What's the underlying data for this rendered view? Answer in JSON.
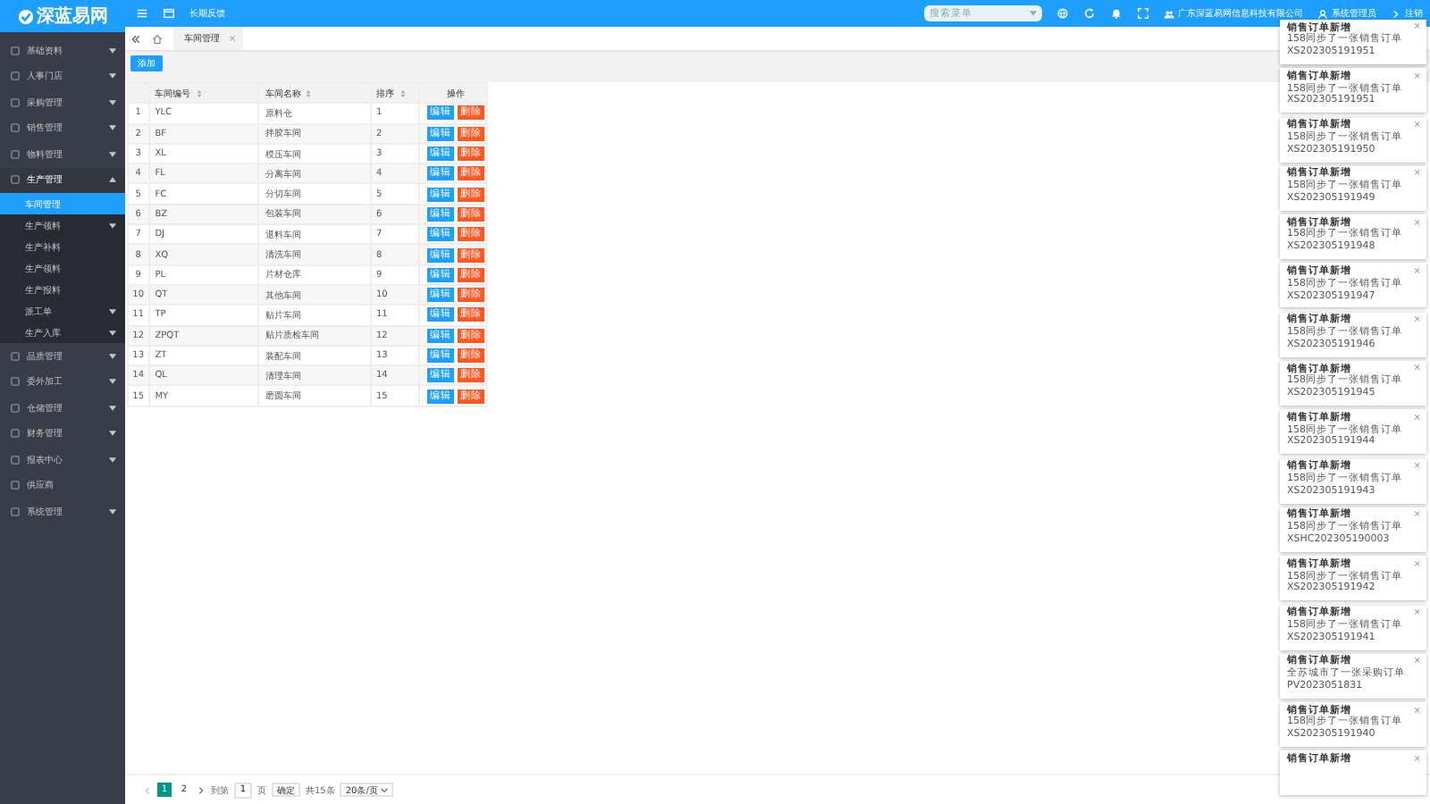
{
  "logo": {
    "text": "深蓝易网"
  },
  "sidebar": {
    "items": [
      {
        "label": "基础资料",
        "kind": "menu",
        "expanded": false,
        "selected": false
      },
      {
        "label": "人事门店",
        "kind": "menu",
        "expanded": false,
        "selected": false
      },
      {
        "label": "采购管理",
        "kind": "menu",
        "expanded": false,
        "selected": false
      },
      {
        "label": "销售管理",
        "kind": "menu",
        "expanded": false,
        "selected": false
      },
      {
        "label": "物料管理",
        "kind": "menu",
        "expanded": false,
        "selected": false
      },
      {
        "label": "生产管理",
        "kind": "menu",
        "expanded": true,
        "selected": false,
        "children": [
          {
            "label": "车间管理",
            "kind": "link",
            "selected": true
          },
          {
            "label": "生产领料",
            "kind": "menu",
            "expanded": false,
            "selected": false
          },
          {
            "label": "生产补料",
            "kind": "link",
            "selected": false
          },
          {
            "label": "生产领料",
            "kind": "link",
            "selected": false
          },
          {
            "label": "生产报料",
            "kind": "link",
            "selected": false
          },
          {
            "label": "派工单",
            "kind": "menu",
            "expanded": false,
            "selected": false
          },
          {
            "label": "生产入库",
            "kind": "menu",
            "expanded": false,
            "selected": false
          }
        ]
      },
      {
        "label": "品质管理",
        "kind": "menu",
        "expanded": false,
        "selected": false
      },
      {
        "label": "委外加工",
        "kind": "menu",
        "expanded": false,
        "selected": false
      },
      {
        "label": "仓储管理",
        "kind": "menu",
        "expanded": false,
        "selected": false
      },
      {
        "label": "财务管理",
        "kind": "menu",
        "expanded": false,
        "selected": false
      },
      {
        "label": "报表中心",
        "kind": "menu",
        "expanded": false,
        "selected": false
      },
      {
        "label": "供应商",
        "kind": "link",
        "selected": false
      },
      {
        "label": "系统管理",
        "kind": "menu",
        "expanded": false,
        "selected": false
      }
    ]
  },
  "topbar": {
    "title": "长期反馈",
    "search": {
      "placeholder": "搜索菜单"
    },
    "company": "广东深蓝易网信息科技有限公司",
    "user": "系统管理员",
    "logout": "注销"
  },
  "tabs": [
    {
      "label": "车间管理",
      "selected": true
    }
  ],
  "toolbar": {
    "add_button": "添加"
  },
  "table": {
    "columns": [
      "车间编号",
      "车间名称",
      "排序",
      "操作"
    ],
    "rows": [
      {
        "index": "1",
        "code": "YLC",
        "name": "原料仓",
        "order": "1",
        "edit": "编辑",
        "delete": "删除"
      },
      {
        "index": "2",
        "code": "BF",
        "name": "拌胶车间",
        "order": "2",
        "edit": "编辑",
        "delete": "删除"
      },
      {
        "index": "3",
        "code": "XL",
        "name": "模压车间",
        "order": "3",
        "edit": "编辑",
        "delete": "删除"
      },
      {
        "index": "4",
        "code": "FL",
        "name": "分离车间",
        "order": "4",
        "edit": "编辑",
        "delete": "删除"
      },
      {
        "index": "5",
        "code": "FC",
        "name": "分切车间",
        "order": "5",
        "edit": "编辑",
        "delete": "删除"
      },
      {
        "index": "6",
        "code": "BZ",
        "name": "包装车间",
        "order": "6",
        "edit": "编辑",
        "delete": "删除"
      },
      {
        "index": "7",
        "code": "DJ",
        "name": "退料车间",
        "order": "7",
        "edit": "编辑",
        "delete": "删除"
      },
      {
        "index": "8",
        "code": "XQ",
        "name": "清洗车间",
        "order": "8",
        "edit": "编辑",
        "delete": "删除"
      },
      {
        "index": "9",
        "code": "PL",
        "name": "片材仓库",
        "order": "9",
        "edit": "编辑",
        "delete": "删除"
      },
      {
        "index": "10",
        "code": "QT",
        "name": "其他车间",
        "order": "10",
        "edit": "编辑",
        "delete": "删除"
      },
      {
        "index": "11",
        "code": "TP",
        "name": "贴片车间",
        "order": "11",
        "edit": "编辑",
        "delete": "删除"
      },
      {
        "index": "12",
        "code": "ZPQT",
        "name": "贴片质检车间",
        "order": "12",
        "edit": "编辑",
        "delete": "删除"
      },
      {
        "index": "13",
        "code": "ZT",
        "name": "装配车间",
        "order": "13",
        "edit": "编辑",
        "delete": "删除"
      },
      {
        "index": "14",
        "code": "QL",
        "name": "清理车间",
        "order": "14",
        "edit": "编辑",
        "delete": "删除"
      },
      {
        "index": "15",
        "code": "MY",
        "name": "磨圆车间",
        "order": "15",
        "edit": "编辑",
        "delete": "删除"
      }
    ]
  },
  "pagination": {
    "pages": [
      {
        "label": "1",
        "selected": true
      },
      {
        "label": "2",
        "selected": false
      }
    ],
    "goto_label": "到第",
    "page_value": "1",
    "page_suffix": "页",
    "confirm": "确定",
    "total": "共15条",
    "page_size": "20条/页"
  },
  "notifications": [
    {
      "title": "销售订单新增",
      "body": "158同步了一张销售订单",
      "number": "XS202305191951"
    },
    {
      "title": "销售订单新增",
      "body": "158同步了一张销售订单",
      "number": "XS202305191951"
    },
    {
      "title": "销售订单新增",
      "body": "158同步了一张销售订单",
      "number": "XS202305191950"
    },
    {
      "title": "销售订单新增",
      "body": "158同步了一张销售订单",
      "number": "XS202305191949"
    },
    {
      "title": "销售订单新增",
      "body": "158同步了一张销售订单",
      "number": "XS202305191948"
    },
    {
      "title": "销售订单新增",
      "body": "158同步了一张销售订单",
      "number": "XS202305191947"
    },
    {
      "title": "销售订单新增",
      "body": "158同步了一张销售订单",
      "number": "XS202305191946"
    },
    {
      "title": "销售订单新增",
      "body": "158同步了一张销售订单",
      "number": "XS202305191945"
    },
    {
      "title": "销售订单新增",
      "body": "158同步了一张销售订单",
      "number": "XS202305191944"
    },
    {
      "title": "销售订单新增",
      "body": "158同步了一张销售订单",
      "number": "XS202305191943"
    },
    {
      "title": "销售订单新增",
      "body": "158同步了一张销售订单",
      "number": "XSHC202305190003"
    },
    {
      "title": "销售订单新增",
      "body": "158同步了一张销售订单",
      "number": "XS202305191942"
    },
    {
      "title": "销售订单新增",
      "body": "158同步了一张销售订单",
      "number": "XS202305191941"
    },
    {
      "title": "销售订单新增",
      "body": "全苏城市了一张采购订单",
      "number": "PV2023051831"
    },
    {
      "title": "销售订单新增",
      "body": "158同步了一张销售订单",
      "number": "XS202305191940"
    },
    {
      "title": "销售订单新增"
    }
  ],
  "close_glyph": "×"
}
